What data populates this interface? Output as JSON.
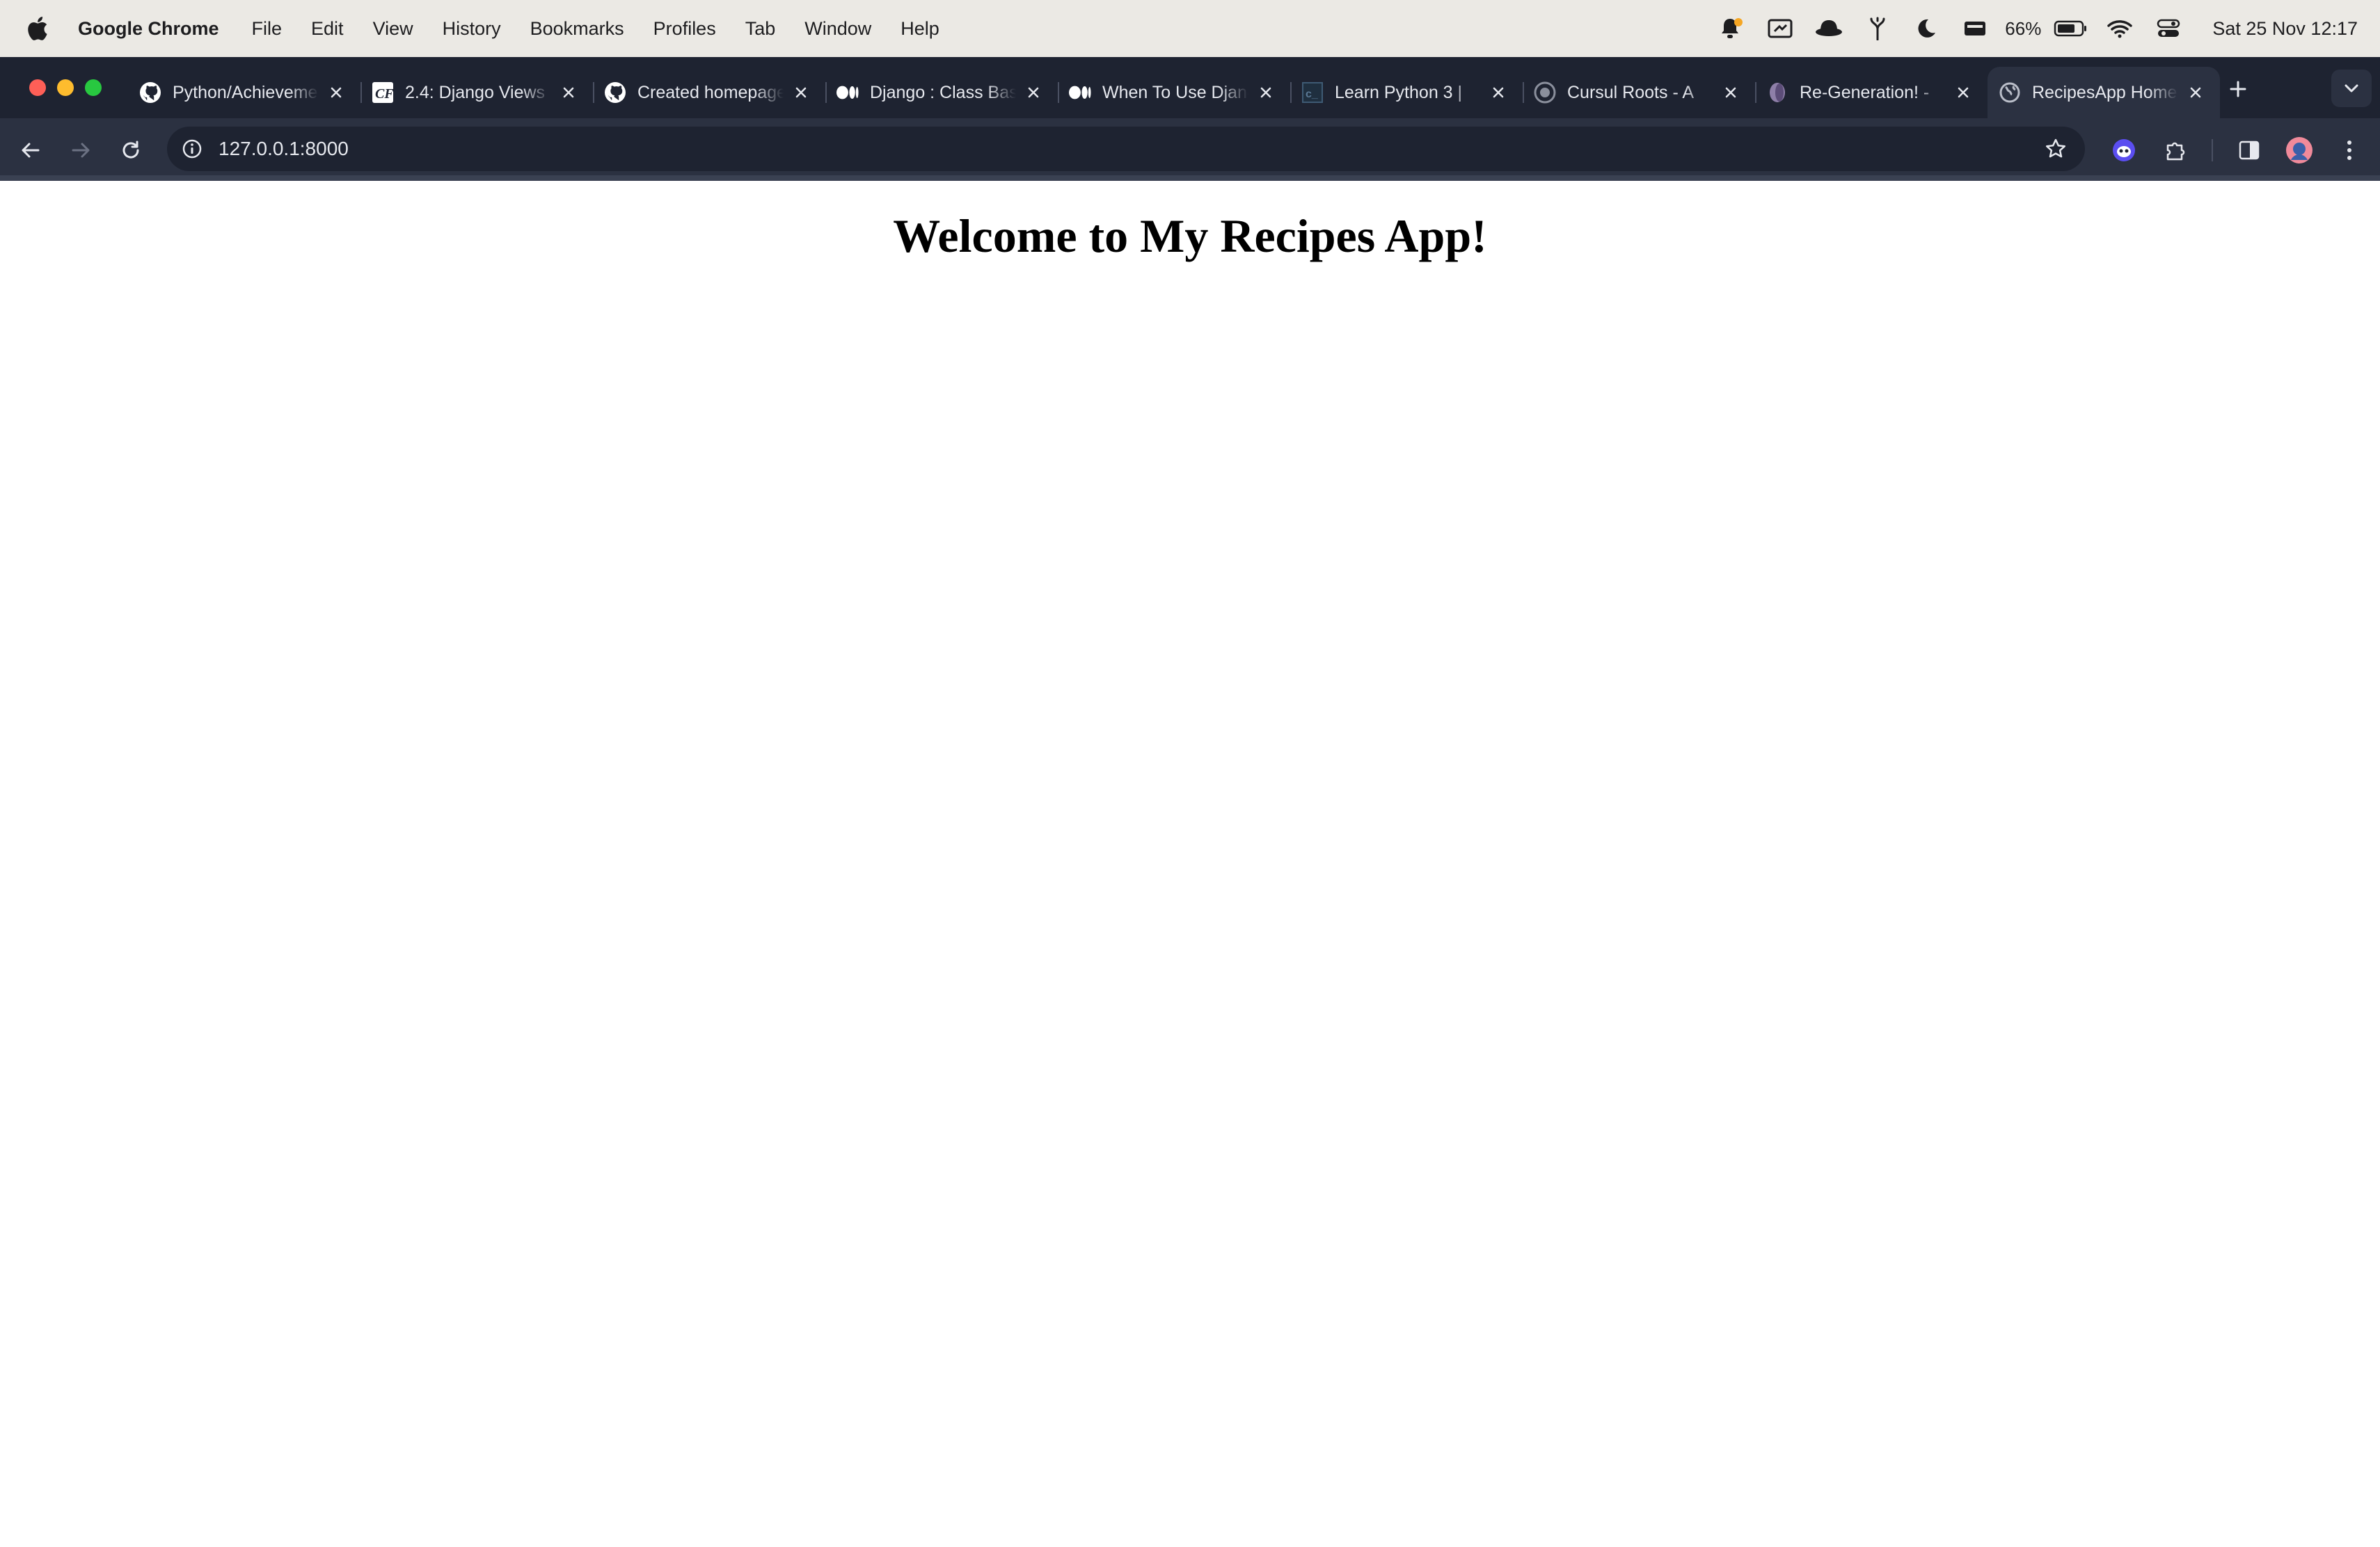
{
  "menubar": {
    "app_name": "Google Chrome",
    "items": [
      "File",
      "Edit",
      "View",
      "History",
      "Bookmarks",
      "Profiles",
      "Tab",
      "Window",
      "Help"
    ],
    "battery": "66%",
    "clock": "Sat 25 Nov  12:17"
  },
  "tabs": [
    {
      "title": "Python/Achievement",
      "icon": "github-icon"
    },
    {
      "title": "2.4: Django Views",
      "icon": "careerfoundry-icon"
    },
    {
      "title": "Created homepage",
      "icon": "github-icon"
    },
    {
      "title": "Django : Class Based",
      "icon": "medium-icon"
    },
    {
      "title": "When To Use Django",
      "icon": "medium-icon"
    },
    {
      "title": "Learn Python 3 |",
      "icon": "codecademy-icon"
    },
    {
      "title": "Cursul Roots - A",
      "icon": "roots-icon"
    },
    {
      "title": "Re-Generation! -",
      "icon": "regeneration-icon"
    },
    {
      "title": "RecipesApp Home",
      "icon": "globe-icon",
      "active": true
    }
  ],
  "address_bar": {
    "url": "127.0.0.1:8000"
  },
  "page": {
    "heading": "Welcome to My Recipes App!"
  },
  "colors": {
    "tabstrip": "#1e2331",
    "toolbar": "#2b3141",
    "menubar": "#ebe9e4",
    "page_bg": "#ffffff"
  }
}
